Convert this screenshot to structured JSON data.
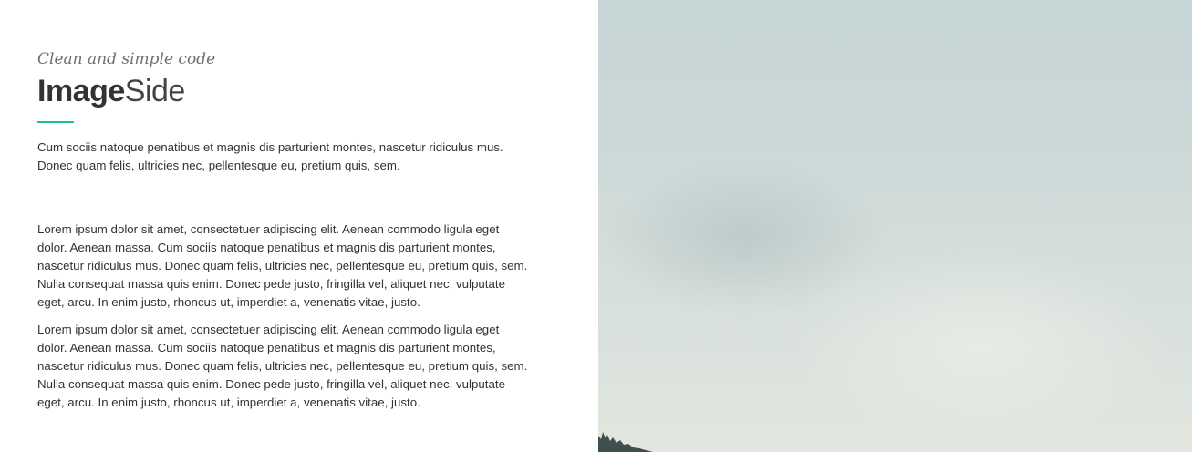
{
  "header": {
    "subtitle": "Clean and simple code",
    "title_bold": "Image",
    "title_light": "Side"
  },
  "content": {
    "lead": "Cum sociis natoque penatibus et magnis dis parturient montes, nascetur ridiculus mus. Donec quam felis, ultricies nec, pellentesque eu, pretium quis, sem.",
    "paragraphs": [
      "Lorem ipsum dolor sit amet, consectetuer adipiscing elit. Aenean commodo ligula eget dolor. Aenean massa. Cum sociis natoque penatibus et magnis dis parturient montes, nascetur ridiculus mus. Donec quam felis, ultricies nec, pellentesque eu, pretium quis, sem. Nulla consequat massa quis enim. Donec pede justo, fringilla vel, aliquet nec, vulputate eget, arcu. In enim justo, rhoncus ut, imperdiet a, venenatis vitae, justo.",
      "Lorem ipsum dolor sit amet, consectetuer adipiscing elit. Aenean commodo ligula eget dolor. Aenean massa. Cum sociis natoque penatibus et magnis dis parturient montes, nascetur ridiculus mus. Donec quam felis, ultricies nec, pellentesque eu, pretium quis, sem. Nulla consequat massa quis enim. Donec pede justo, fringilla vel, aliquet nec, vulputate eget, arcu. In enim justo, rhoncus ut, imperdiet a, venenatis vitae, justo."
    ]
  },
  "colors": {
    "accent": "#1abc9c",
    "text": "#333333",
    "subtitle": "#6f6f6f"
  },
  "image": {
    "description_icon": "foggy-sky-photo"
  }
}
